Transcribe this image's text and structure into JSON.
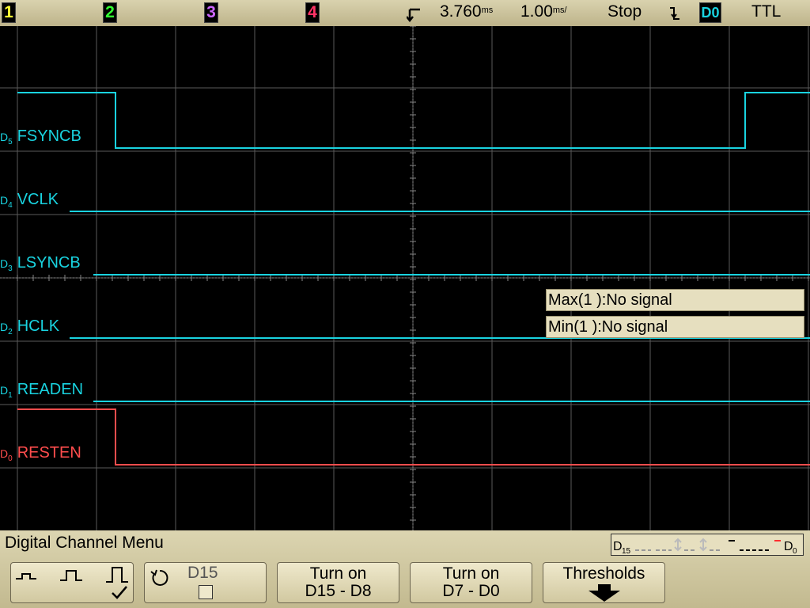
{
  "status_bar": {
    "channels": [
      {
        "label": "1",
        "color": "#ffff33"
      },
      {
        "label": "2",
        "color": "#33ff33"
      },
      {
        "label": "3",
        "color": "#cc66ff"
      },
      {
        "label": "4",
        "color": "#ff3366"
      }
    ],
    "trigger_icon": "trigger-position-icon",
    "delay_value": "3.760",
    "delay_unit": "ms",
    "timebase_value": "1.00",
    "timebase_unit": "ms/",
    "run_state": "Stop",
    "edge_icon": "falling-edge-icon",
    "trigger_source": "D0",
    "threshold": "TTL"
  },
  "channels_digital": [
    {
      "id": "D5",
      "num": "D",
      "sub": "5",
      "name": "FSYNCB",
      "color": "#19d3e0"
    },
    {
      "id": "D4",
      "num": "D",
      "sub": "4",
      "name": "VCLK",
      "color": "#19d3e0"
    },
    {
      "id": "D3",
      "num": "D",
      "sub": "3",
      "name": "LSYNCB",
      "color": "#19d3e0"
    },
    {
      "id": "D2",
      "num": "D",
      "sub": "2",
      "name": "HCLK",
      "color": "#19d3e0"
    },
    {
      "id": "D1",
      "num": "D",
      "sub": "1",
      "name": "READEN",
      "color": "#19d3e0"
    },
    {
      "id": "D0",
      "num": "D",
      "sub": "0",
      "name": "RESTEN",
      "color": "#ff4d4d"
    }
  ],
  "measurements": [
    {
      "label": "Max(1 ):No signal"
    },
    {
      "label": "Min(1 ):No signal"
    }
  ],
  "menu": {
    "title": "Digital Channel Menu",
    "activity": {
      "left": "D",
      "left_sub": "15",
      "right": "D",
      "right_sub": "0"
    },
    "softkeys": {
      "size": {
        "icons": [
          "small-size-icon",
          "medium-size-icon",
          "large-size-icon"
        ],
        "check_icon": "checkmark-icon"
      },
      "channel": {
        "icon": "rotate-knob-icon",
        "label": "D15",
        "checkbox_icon": "checkbox-icon"
      },
      "turn_on_high": {
        "line1": "Turn on",
        "line2": "D15 - D8"
      },
      "turn_on_low": {
        "line1": "Turn on",
        "line2": "D7 - D0"
      },
      "thresholds": {
        "line1": "Thresholds",
        "icon": "down-arrow-icon"
      }
    }
  }
}
